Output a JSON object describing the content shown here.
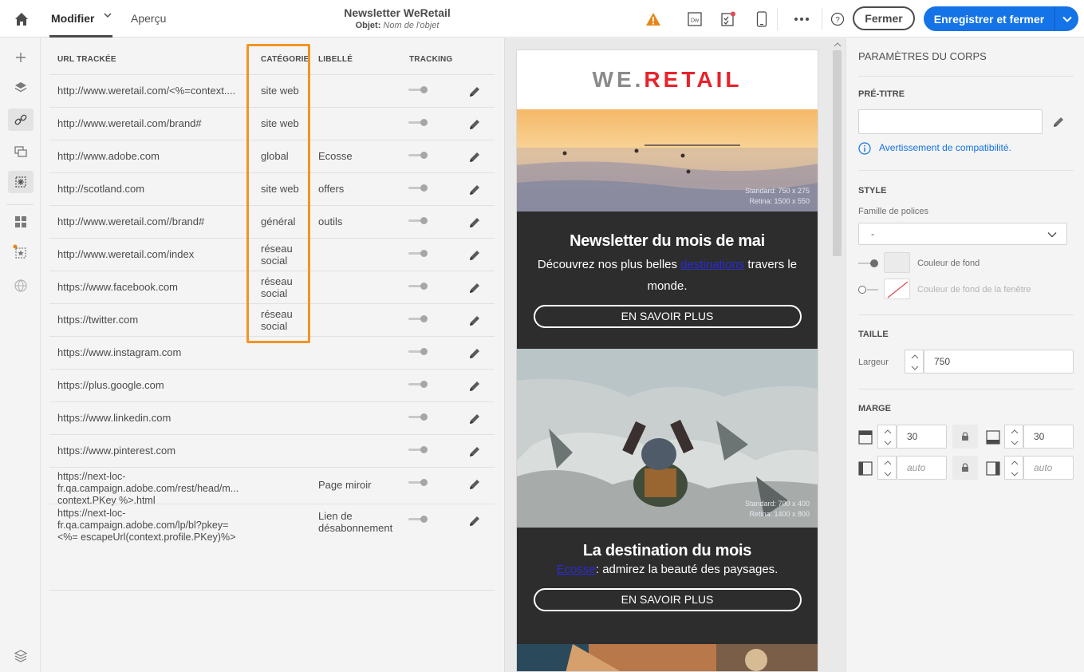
{
  "header": {
    "tabs": [
      "Modifier",
      "Aperçu"
    ],
    "title": "Newsletter WeRetail",
    "subject_label": "Objet:",
    "subject_value": "Nom de l'objet",
    "close_label": "Fermer",
    "save_label": "Enregistrer et fermer"
  },
  "table": {
    "columns": [
      "URL TRACKÉE",
      "CATÉGORIE",
      "LIBELLÉ",
      "TRACKING"
    ],
    "rows": [
      {
        "url": "http://www.weretail.com/<%=context....",
        "category": "site web",
        "label": ""
      },
      {
        "url": "http://www.weretail.com/brand#",
        "category": "site web",
        "label": ""
      },
      {
        "url": "http://www.adobe.com",
        "category": "global",
        "label": "Ecosse"
      },
      {
        "url": "http://scotland.com",
        "category": "site web",
        "label": "offers"
      },
      {
        "url": "http://www.weretail.com//brand#",
        "category": "général",
        "label": "outils"
      },
      {
        "url": "http://www.weretail.com/index",
        "category": "réseau social",
        "label": ""
      },
      {
        "url": "https://www.facebook.com",
        "category": "réseau social",
        "label": ""
      },
      {
        "url": "https://twitter.com",
        "category": "réseau social",
        "label": ""
      },
      {
        "url": "https://www.instagram.com",
        "category": "",
        "label": ""
      },
      {
        "url": "https://plus.google.com",
        "category": "",
        "label": ""
      },
      {
        "url": "https://www.linkedin.com",
        "category": "",
        "label": ""
      },
      {
        "url": "https://www.pinterest.com",
        "category": "",
        "label": ""
      },
      {
        "url": "https://next-loc-fr.qa.campaign.adobe.com/rest/head/m... context.PKey %>.html",
        "category": "",
        "label": "Page miroir"
      },
      {
        "url": "https://next-loc-fr.qa.campaign.adobe.com/lp/bl?pkey=<%= escapeUrl(context.profile.PKey)%>",
        "category": "",
        "label": "Lien de désabonnement"
      }
    ]
  },
  "email": {
    "logo_left": "WE.",
    "logo_right": "RETAIL",
    "hero_caption_1": "Standard: 750 x 275",
    "hero_caption_2": "Retina: 1500 x 550",
    "block1_title": "Newsletter du mois de mai",
    "block1_text_before": "Découvrez nos plus belles ",
    "block1_link": "destinations",
    "block1_text_after": " travers le monde.",
    "cta": "EN SAVOIR PLUS",
    "hero2_caption_1": "Standard: 700 x 400",
    "hero2_caption_2": "Retina: 1400 x 800",
    "block2_title": "La destination du mois",
    "block2_link": "Ecosse",
    "block2_text": ": admirez la beauté des paysages.",
    "cta2": "EN SAVOIR PLUS"
  },
  "panel": {
    "title": "PARAMÈTRES DU CORPS",
    "pretitle": "PRÉ-TITRE",
    "compat": "Avertissement de compatibilité.",
    "style": "STYLE",
    "font_family_label": "Famille de polices",
    "font_family_value": "-",
    "bg_color": "Couleur de fond",
    "window_bg_color": "Couleur de fond de la fenêtre",
    "size": "TAILLE",
    "width_label": "Largeur",
    "width_value": "750",
    "margin": "MARGE",
    "margin_top": "30",
    "margin_bottom": "30",
    "margin_left": "auto",
    "margin_right": "auto"
  },
  "colors": {
    "accent": "#1473e6",
    "highlight": "#f29423",
    "retail_red": "#e8232b",
    "dark_block": "#2d2d2d"
  }
}
